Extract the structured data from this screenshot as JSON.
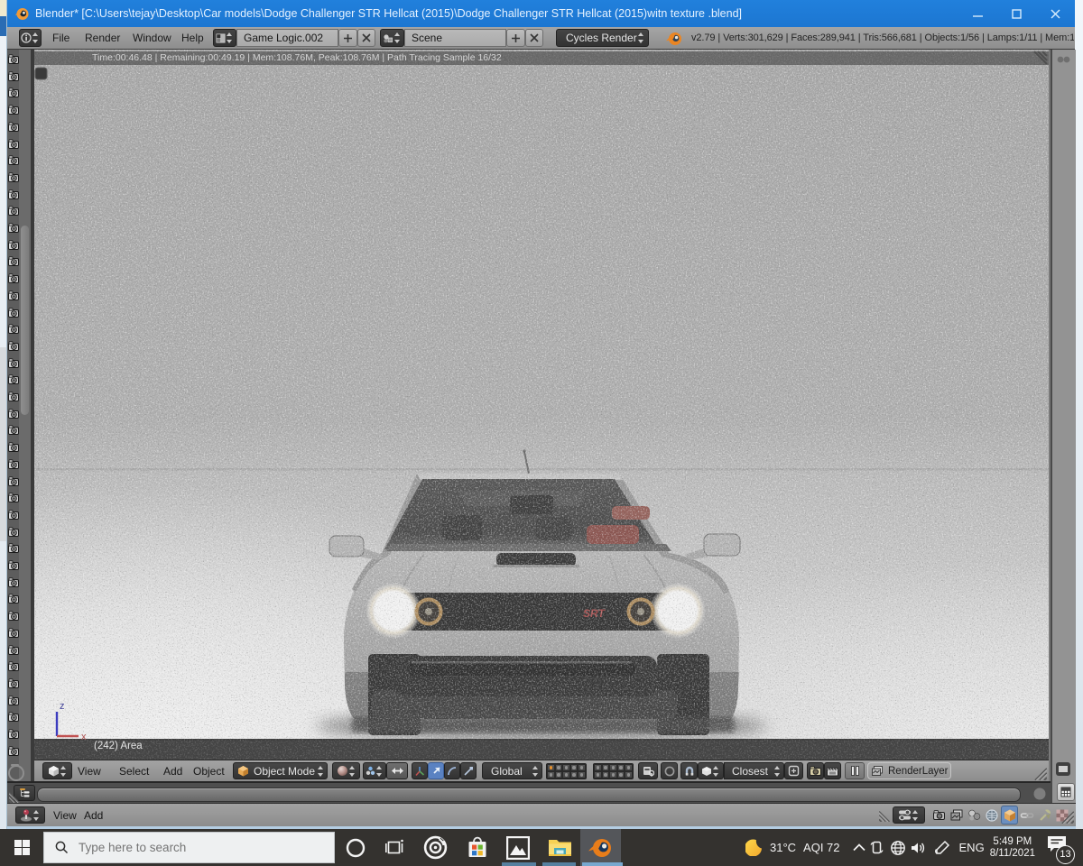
{
  "titlebar": {
    "title": "Blender* [C:\\Users\\tejay\\Desktop\\Car models\\Dodge Challenger STR Hellcat (2015)\\Dodge Challenger STR Hellcat (2015)witn texture .blend]",
    "minimize_glyph": "—",
    "close_glyph": "✕"
  },
  "info_header": {
    "menus": [
      {
        "label": "File"
      },
      {
        "label": "Render"
      },
      {
        "label": "Window"
      },
      {
        "label": "Help"
      }
    ],
    "screen_layout": {
      "value": "Game Logic.002",
      "add_glyph": "+",
      "remove_glyph": "✕"
    },
    "scene": {
      "value": "Scene",
      "add_glyph": "+",
      "remove_glyph": "✕"
    },
    "engine": {
      "value": "Cycles Render"
    },
    "stats": "v2.79 | Verts:301,629 | Faces:289,941 | Tris:566,681 | Objects:1/56 | Lamps:1/11 | Mem:1"
  },
  "viewport": {
    "render_status": "Time:00:46.48 | Remaining:00:49.19 | Mem:108.76M, Peak:108.76M | Path Tracing Sample 16/32",
    "active_object": "(242) Area",
    "axis_x_label": "x",
    "axis_z_label": "z"
  },
  "left_strip": {
    "icon": "camera-icon",
    "camera_count": 42
  },
  "view3d_header": {
    "menus": [
      {
        "label": "View"
      },
      {
        "label": "Select"
      },
      {
        "label": "Add"
      },
      {
        "label": "Object"
      }
    ],
    "mode": {
      "value": "Object Mode"
    },
    "orientation": {
      "value": "Global"
    },
    "snap_element": {
      "value": "Closest"
    },
    "render_layer": {
      "value": "RenderLayer"
    },
    "layers": {
      "groups": 2,
      "per_group": 10,
      "active_index": 0
    }
  },
  "logic_header": {
    "menus": [
      {
        "label": "View"
      },
      {
        "label": "Add"
      }
    ]
  },
  "properties_header": {
    "tabs": [
      {
        "name": "render"
      },
      {
        "name": "render-layers"
      },
      {
        "name": "scene"
      },
      {
        "name": "world"
      },
      {
        "name": "object",
        "selected": true
      },
      {
        "name": "constraints"
      },
      {
        "name": "modifiers"
      },
      {
        "name": "texture"
      }
    ],
    "selected_color": "#6c8fbf"
  },
  "taskbar": {
    "search": {
      "placeholder": "Type here to search"
    },
    "apps": [
      {
        "name": "cortana"
      },
      {
        "name": "task-view"
      },
      {
        "name": "target-app"
      },
      {
        "name": "microsoft-store"
      },
      {
        "name": "photos",
        "running": true
      },
      {
        "name": "file-explorer",
        "running": true
      },
      {
        "name": "blender",
        "running": true,
        "active": true
      }
    ],
    "tray": {
      "temperature": "31°C",
      "aqi": "AQI 72",
      "language": "ENG",
      "time": "5:49 PM",
      "date": "8/11/2021",
      "notification_count": "13"
    }
  },
  "colors": {
    "titlebar_blue": "#1f7ad4",
    "blender_orange": "#ea7600",
    "taskbar": "#34322f",
    "running_underline": "#56809f",
    "selected_tab": "#6c8fbf"
  }
}
